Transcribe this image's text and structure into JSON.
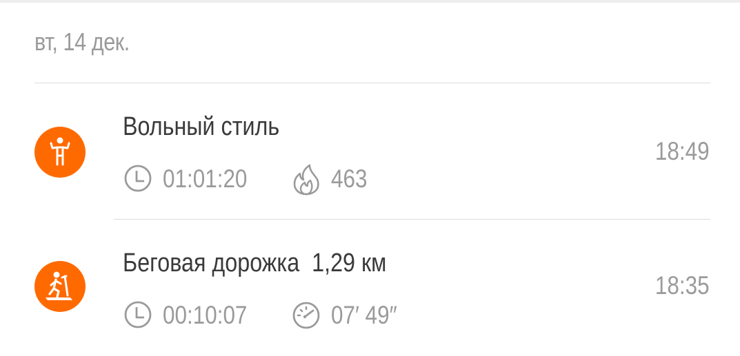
{
  "date_header": "вт, 14 дек.",
  "colors": {
    "accent": "#ff6a00",
    "muted": "#9a9a9a",
    "title": "#3a3a3a",
    "divider": "#dddddd"
  },
  "activities": [
    {
      "icon": "freestyle-person-icon",
      "title": "Вольный стиль",
      "duration_icon": "clock-icon",
      "duration": "01:01:20",
      "secondary_icon": "flame-icon",
      "secondary": "463",
      "time": "18:49"
    },
    {
      "icon": "treadmill-icon",
      "title": "Беговая дорожка  1,29 км",
      "duration_icon": "clock-icon",
      "duration": "00:10:07",
      "secondary_icon": "pace-gauge-icon",
      "secondary": "07′ 49″",
      "time": "18:35"
    }
  ]
}
